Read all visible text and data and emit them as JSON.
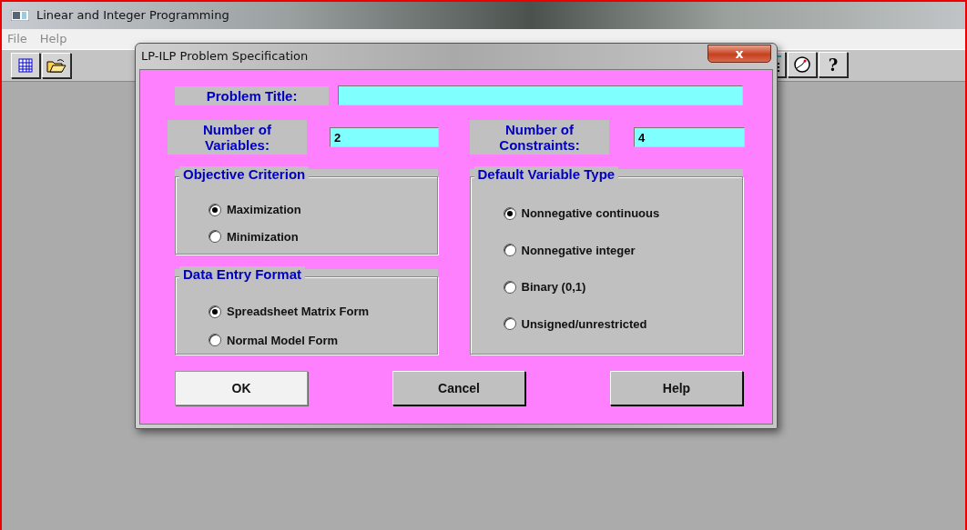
{
  "window": {
    "title": "Linear and Integer Programming"
  },
  "menu": [
    {
      "label": "File"
    },
    {
      "label": "Help"
    }
  ],
  "toolbar": {
    "help_glyph": "?"
  },
  "dialog": {
    "title": "LP-ILP Problem Specification",
    "close_glyph": "x",
    "problem_title": {
      "label": "Problem Title:"
    },
    "variables": {
      "label": "Number of Variables:",
      "value": "2"
    },
    "constraints": {
      "label": "Number of Constraints:",
      "value": "4"
    },
    "groups": [
      {
        "title": "Objective Criterion",
        "options": [
          {
            "label": "Maximization",
            "selected": true
          },
          {
            "label": "Minimization",
            "selected": false
          }
        ]
      },
      {
        "title": "Data Entry Format",
        "options": [
          {
            "label": "Spreadsheet Matrix Form",
            "selected": true
          },
          {
            "label": "Normal Model Form",
            "selected": false
          }
        ]
      },
      {
        "title": "Default Variable Type",
        "options": [
          {
            "label": "Nonnegative continuous",
            "selected": true
          },
          {
            "label": "Nonnegative integer",
            "selected": false
          },
          {
            "label": "Binary (0,1)",
            "selected": false
          },
          {
            "label": "Unsigned/unrestricted",
            "selected": false
          }
        ]
      }
    ],
    "buttons": [
      {
        "label": "OK",
        "focused": true
      },
      {
        "label": "Cancel",
        "focused": false
      },
      {
        "label": "Help",
        "focused": false
      }
    ]
  }
}
